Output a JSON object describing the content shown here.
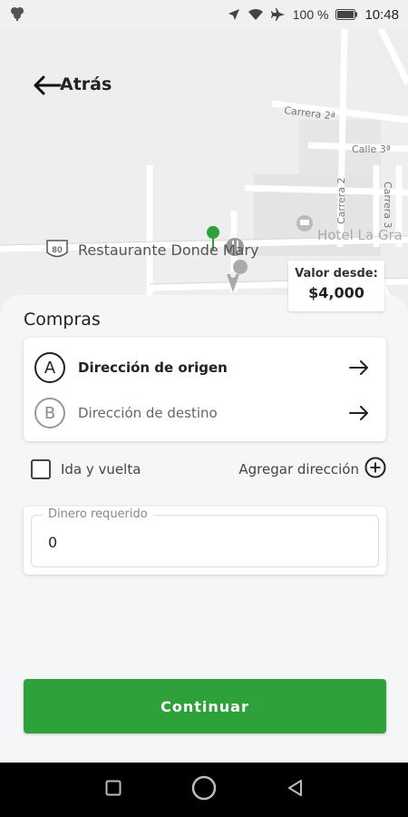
{
  "status_bar": {
    "battery_percent": "100 %",
    "time": "10:48",
    "icons": [
      "clover-icon",
      "location-arrow-icon",
      "wifi-icon",
      "airplane-icon",
      "battery-icon"
    ]
  },
  "header": {
    "back_label": "Atrás"
  },
  "map": {
    "place_name": "Restaurante Donde Mary",
    "road_shield": "80",
    "hotel_label": "Hotel La Gra",
    "streets": [
      "Carrera 2ª",
      "Calle 3ª",
      "Carrera 2",
      "Carrera 3"
    ],
    "pin_color": "#2ea13a",
    "price_tag": {
      "label": "Valor desde:",
      "value": "$4,000"
    }
  },
  "sheet": {
    "title": "Compras",
    "origin": {
      "letter": "A",
      "label": "Dirección de origen"
    },
    "destination": {
      "letter": "B",
      "label": "Dirección de destino"
    },
    "round_trip_label": "Ida y vuelta",
    "round_trip_checked": false,
    "add_address_label": "Agregar dirección",
    "money_field": {
      "label": "Dinero requerido",
      "value": "0"
    },
    "continue_label": "Continuar",
    "accent_color": "#2ea13a"
  }
}
